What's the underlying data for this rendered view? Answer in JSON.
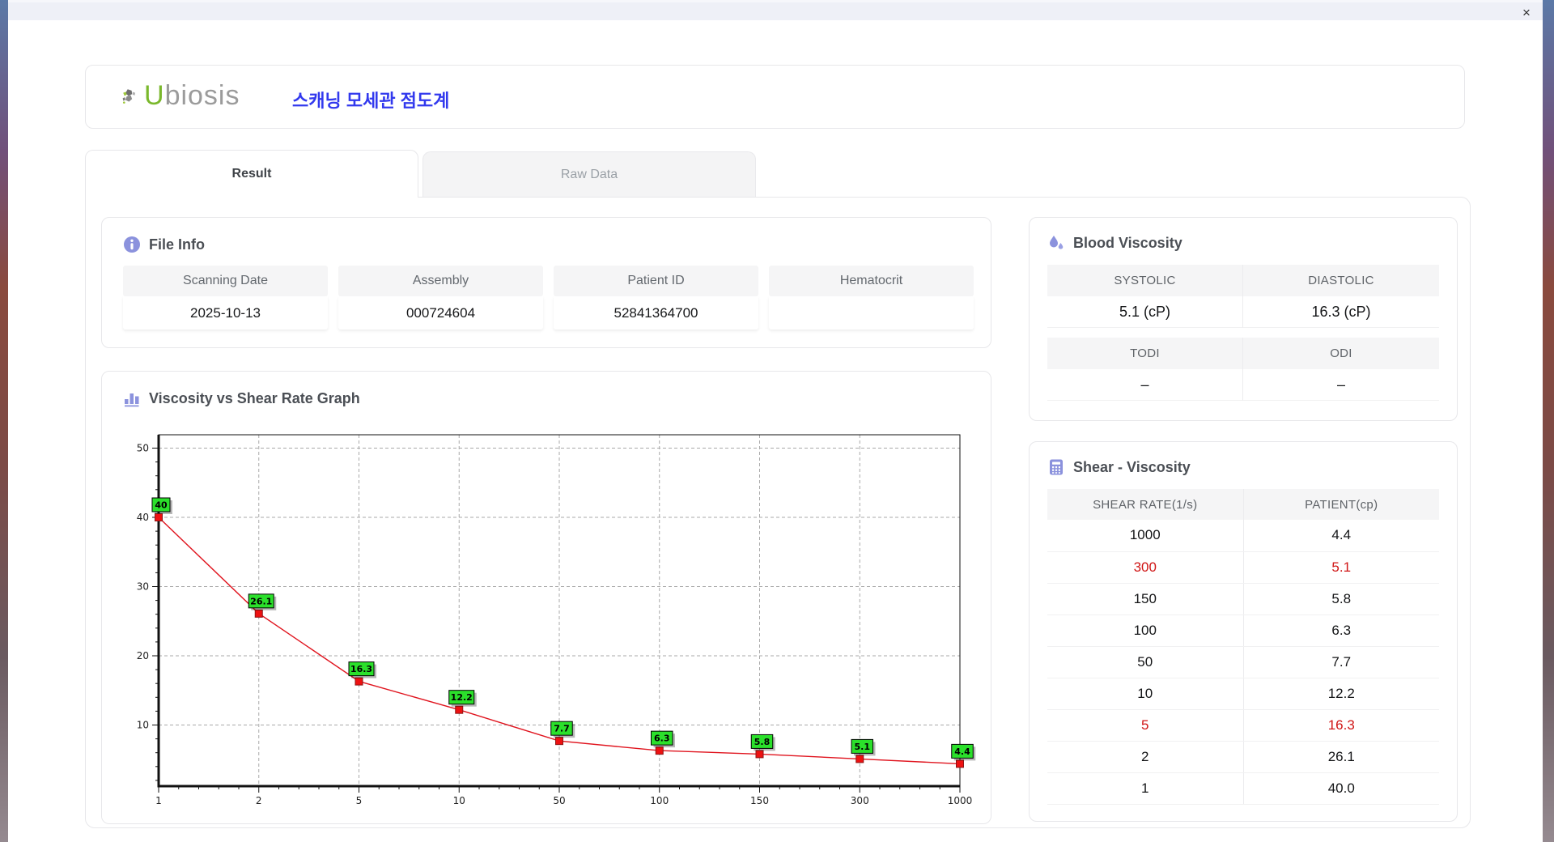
{
  "window": {
    "close_label": "×"
  },
  "header": {
    "logo_u": "U",
    "logo_rest": "biosis",
    "app_title": "스캐닝 모세관 점도계"
  },
  "tabs": [
    {
      "label": "Result",
      "active": true
    },
    {
      "label": "Raw Data",
      "active": false
    }
  ],
  "file_info": {
    "title": "File Info",
    "fields": [
      {
        "label": "Scanning Date",
        "value": "2025-10-13"
      },
      {
        "label": "Assembly",
        "value": "000724604"
      },
      {
        "label": "Patient ID",
        "value": "52841364700"
      },
      {
        "label": "Hematocrit",
        "value": ""
      }
    ]
  },
  "blood_viscosity": {
    "title": "Blood Viscosity",
    "tables": [
      {
        "headers": [
          "SYSTOLIC",
          "DIASTOLIC"
        ],
        "values": [
          "5.1 (cP)",
          "16.3 (cP)"
        ]
      },
      {
        "headers": [
          "TODI",
          "ODI"
        ],
        "values": [
          "–",
          "–"
        ]
      }
    ]
  },
  "shear_viscosity": {
    "title": "Shear - Viscosity",
    "columns": [
      "SHEAR RATE(1/s)",
      "PATIENT(cp)"
    ],
    "rows": [
      {
        "shear": "1000",
        "patient": "4.4",
        "highlight": false
      },
      {
        "shear": "300",
        "patient": "5.1",
        "highlight": true
      },
      {
        "shear": "150",
        "patient": "5.8",
        "highlight": false
      },
      {
        "shear": "100",
        "patient": "6.3",
        "highlight": false
      },
      {
        "shear": "50",
        "patient": "7.7",
        "highlight": false
      },
      {
        "shear": "10",
        "patient": "12.2",
        "highlight": false
      },
      {
        "shear": "5",
        "patient": "16.3",
        "highlight": true
      },
      {
        "shear": "2",
        "patient": "26.1",
        "highlight": false
      },
      {
        "shear": "1",
        "patient": "40.0",
        "highlight": false
      }
    ]
  },
  "graph": {
    "title": "Viscosity vs Shear Rate Graph"
  },
  "chart_data": {
    "type": "line",
    "title": "Viscosity vs Shear Rate Graph",
    "x_scale": "categorical",
    "categories": [
      "1",
      "2",
      "5",
      "10",
      "50",
      "100",
      "150",
      "300",
      "1000"
    ],
    "series": [
      {
        "name": "PATIENT(cp)",
        "values": [
          40,
          26.1,
          16.3,
          12.2,
          7.7,
          6.3,
          5.8,
          5.1,
          4.4
        ]
      }
    ],
    "point_labels": [
      "40",
      "26.1",
      "16.3",
      "12.2",
      "7.7",
      "6.3",
      "5.8",
      "5.1",
      "4.4"
    ],
    "xlabel": "",
    "ylabel": "",
    "yticks": [
      10,
      20,
      30,
      40,
      50
    ],
    "ylim": [
      1.2,
      51.9
    ],
    "grid": "dashed",
    "legend": "none",
    "line_color": "#e0141e",
    "marker_color": "#ee1111",
    "marker_border": "#8b1515",
    "label_box_color": "#2be02b",
    "grid_color": "#a9a9a9"
  },
  "icons": {
    "info": "info-icon",
    "droplets": "droplets-icon",
    "bar_chart": "bar-chart-icon",
    "calculator": "calculator-icon",
    "close": "close-icon",
    "logo": "ubiosis-logo-icon"
  },
  "colors": {
    "accent_periwinkle": "#8b92dd",
    "app_title_blue": "#3239ee",
    "highlight_red": "#d01616",
    "logo_green": "#7ab82c",
    "logo_gray": "#9b9b9b",
    "titlebar": "#eef0f7"
  }
}
